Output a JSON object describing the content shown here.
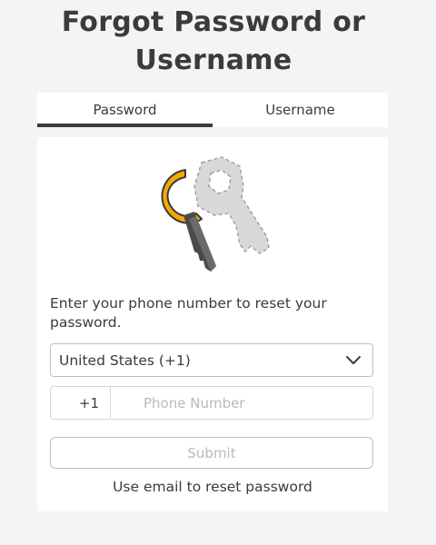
{
  "page": {
    "title": "Forgot Password or Username"
  },
  "tabs": [
    {
      "label": "Password",
      "active": true
    },
    {
      "label": "Username",
      "active": false
    }
  ],
  "form": {
    "instruction": "Enter your phone number to reset your password.",
    "country_select": {
      "selected": "United States (+1)",
      "icon": "chevron-down-icon"
    },
    "phone": {
      "prefix": "+1",
      "value": "",
      "placeholder": "Phone Number"
    },
    "submit_label": "Submit",
    "email_link": "Use email to reset password"
  },
  "illustration": {
    "icon": "key-icon"
  },
  "colors": {
    "background": "#f2f4f5",
    "card": "#ffffff",
    "text": "#393b3d",
    "active_tab_underline": "#393b3d",
    "key_gold": "#f6a906",
    "key_silver": "#d8d8d8",
    "disabled_text": "#b8b9ba"
  }
}
